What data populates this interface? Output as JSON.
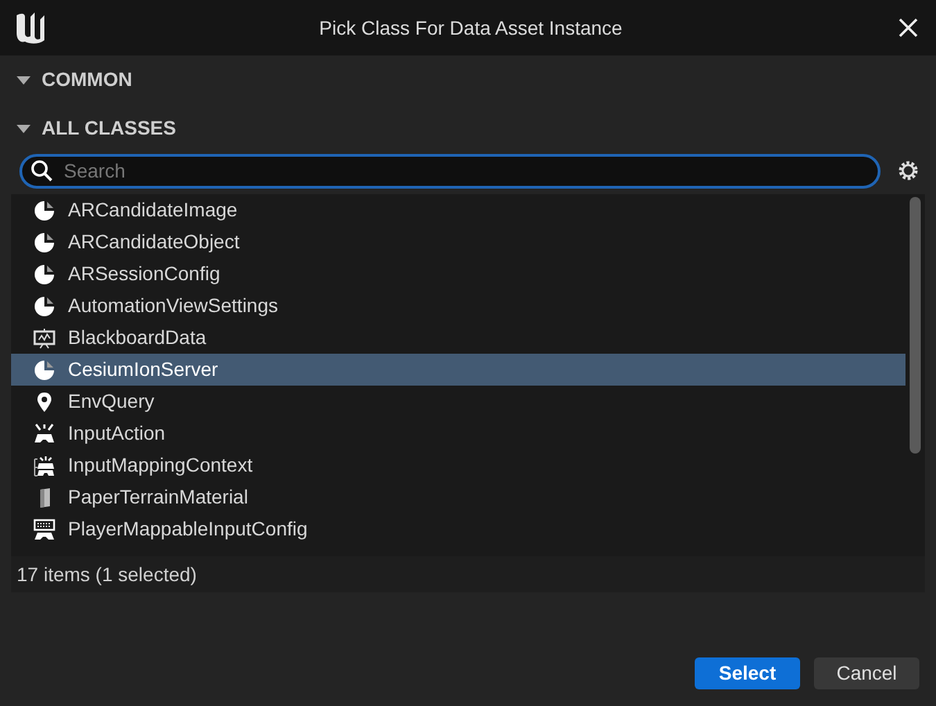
{
  "window": {
    "title": "Pick Class For Data Asset Instance"
  },
  "sections": [
    {
      "label": "COMMON",
      "expanded": true
    },
    {
      "label": "ALL CLASSES",
      "expanded": true
    }
  ],
  "search": {
    "placeholder": "Search"
  },
  "classes": [
    {
      "name": "ARCandidateImage",
      "kind": "asset",
      "selected": false
    },
    {
      "name": "ARCandidateObject",
      "kind": "asset",
      "selected": false
    },
    {
      "name": "ARSessionConfig",
      "kind": "asset",
      "selected": false
    },
    {
      "name": "AutomationViewSettings",
      "kind": "asset",
      "selected": false
    },
    {
      "name": "BlackboardData",
      "kind": "board",
      "selected": false
    },
    {
      "name": "CesiumIonServer",
      "kind": "asset",
      "selected": true
    },
    {
      "name": "EnvQuery",
      "kind": "pin",
      "selected": false
    },
    {
      "name": "InputAction",
      "kind": "gamepad",
      "selected": false
    },
    {
      "name": "InputMappingContext",
      "kind": "mapping",
      "selected": false
    },
    {
      "name": "PaperTerrainMaterial",
      "kind": "paper",
      "selected": false
    },
    {
      "name": "PlayerMappableInputConfig",
      "kind": "keyboard",
      "selected": false
    }
  ],
  "status_bar": "17 items (1 selected)",
  "buttons": [
    {
      "label": "Select",
      "kind": "primary"
    },
    {
      "label": "Cancel",
      "kind": "secondary"
    }
  ]
}
